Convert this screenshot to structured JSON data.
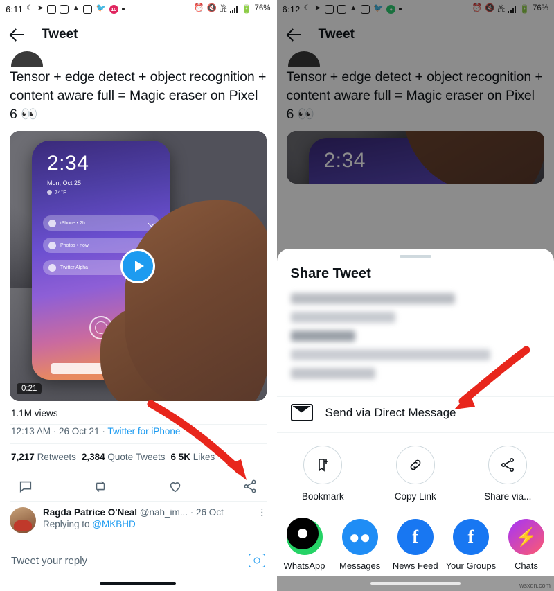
{
  "left": {
    "status": {
      "time": "6:11",
      "battery": "76%",
      "network": "VoLTE",
      "icons": [
        "moon-icon",
        "chevron-right-icon",
        "camera-icon",
        "instagram-icon",
        "android-icon",
        "linkedin-icon",
        "twitter-icon",
        "badge-icon",
        "dot-icon"
      ],
      "right_icons": [
        "alarm-icon",
        "mute-icon",
        "volte-icon",
        "signal-icon",
        "battery-icon"
      ]
    },
    "appbar": {
      "title": "Tweet",
      "back": "back-arrow"
    },
    "tweet": {
      "text": "Tensor + edge detect + object recognition + content aware full = Magic eraser on Pixel 6 👀",
      "media": {
        "duration": "0:21",
        "phone_time": "2:34",
        "phone_date": "Mon, Oct 25",
        "phone_temp": "74°F",
        "cards": [
          "iPhone • 2h",
          "Photos • now",
          "Twitter Alpha"
        ]
      },
      "views": "1.1M views",
      "timestamp": "12:13 AM · 26 Oct 21 · ",
      "client": "Twitter for iPhone",
      "stats": [
        {
          "count": "7,217",
          "label": "Retweets"
        },
        {
          "count": "2,384",
          "label": "Quote Tweets"
        },
        {
          "count": "6   5K",
          "label": "Likes"
        }
      ],
      "actions": [
        "reply-icon",
        "retweet-icon",
        "like-icon",
        "share-icon"
      ]
    },
    "reply": {
      "name": "Ragda Patrice O'Neal",
      "handle": "@nah_im...",
      "time": "· 26 Oct",
      "replying_prefix": "Replying to ",
      "replying_to": "@MKBHD"
    },
    "composer": {
      "placeholder": "Tweet your reply",
      "camera": "camera-icon"
    }
  },
  "right": {
    "status": {
      "time": "6:12",
      "battery": "76%",
      "network": "VoLTE"
    },
    "appbar": {
      "title": "Tweet"
    },
    "tweet_text": "Tensor + edge detect + object recognition + content aware full = Magic eraser on Pixel 6 👀",
    "sheet": {
      "title": "Share Tweet",
      "dm_label": "Send via Direct Message",
      "icons": [
        {
          "name": "bookmark-add-icon",
          "label": "Bookmark"
        },
        {
          "name": "copy-link-icon",
          "label": "Copy Link"
        },
        {
          "name": "share-via-icon",
          "label": "Share via..."
        }
      ],
      "apps": [
        {
          "name": "whatsapp",
          "label": "WhatsApp",
          "color": "#25d366",
          "glyph": "✆"
        },
        {
          "name": "messages",
          "label": "Messages",
          "color": "#1f8df5",
          "glyph": "…"
        },
        {
          "name": "news-feed",
          "label": "News Feed",
          "color": "#1877f2",
          "glyph": "f"
        },
        {
          "name": "your-groups",
          "label": "Your Groups",
          "color": "#1877f2",
          "glyph": "f"
        },
        {
          "name": "chats",
          "label": "Chats",
          "color": "#a334fa",
          "glyph": "⚡"
        }
      ]
    },
    "watermark": "wsxdn.com"
  },
  "colors": {
    "accent": "#1d9bf0",
    "text": "#0f1419",
    "muted": "#536471",
    "arrow": "#e8261c",
    "divider": "#eff3f4"
  }
}
